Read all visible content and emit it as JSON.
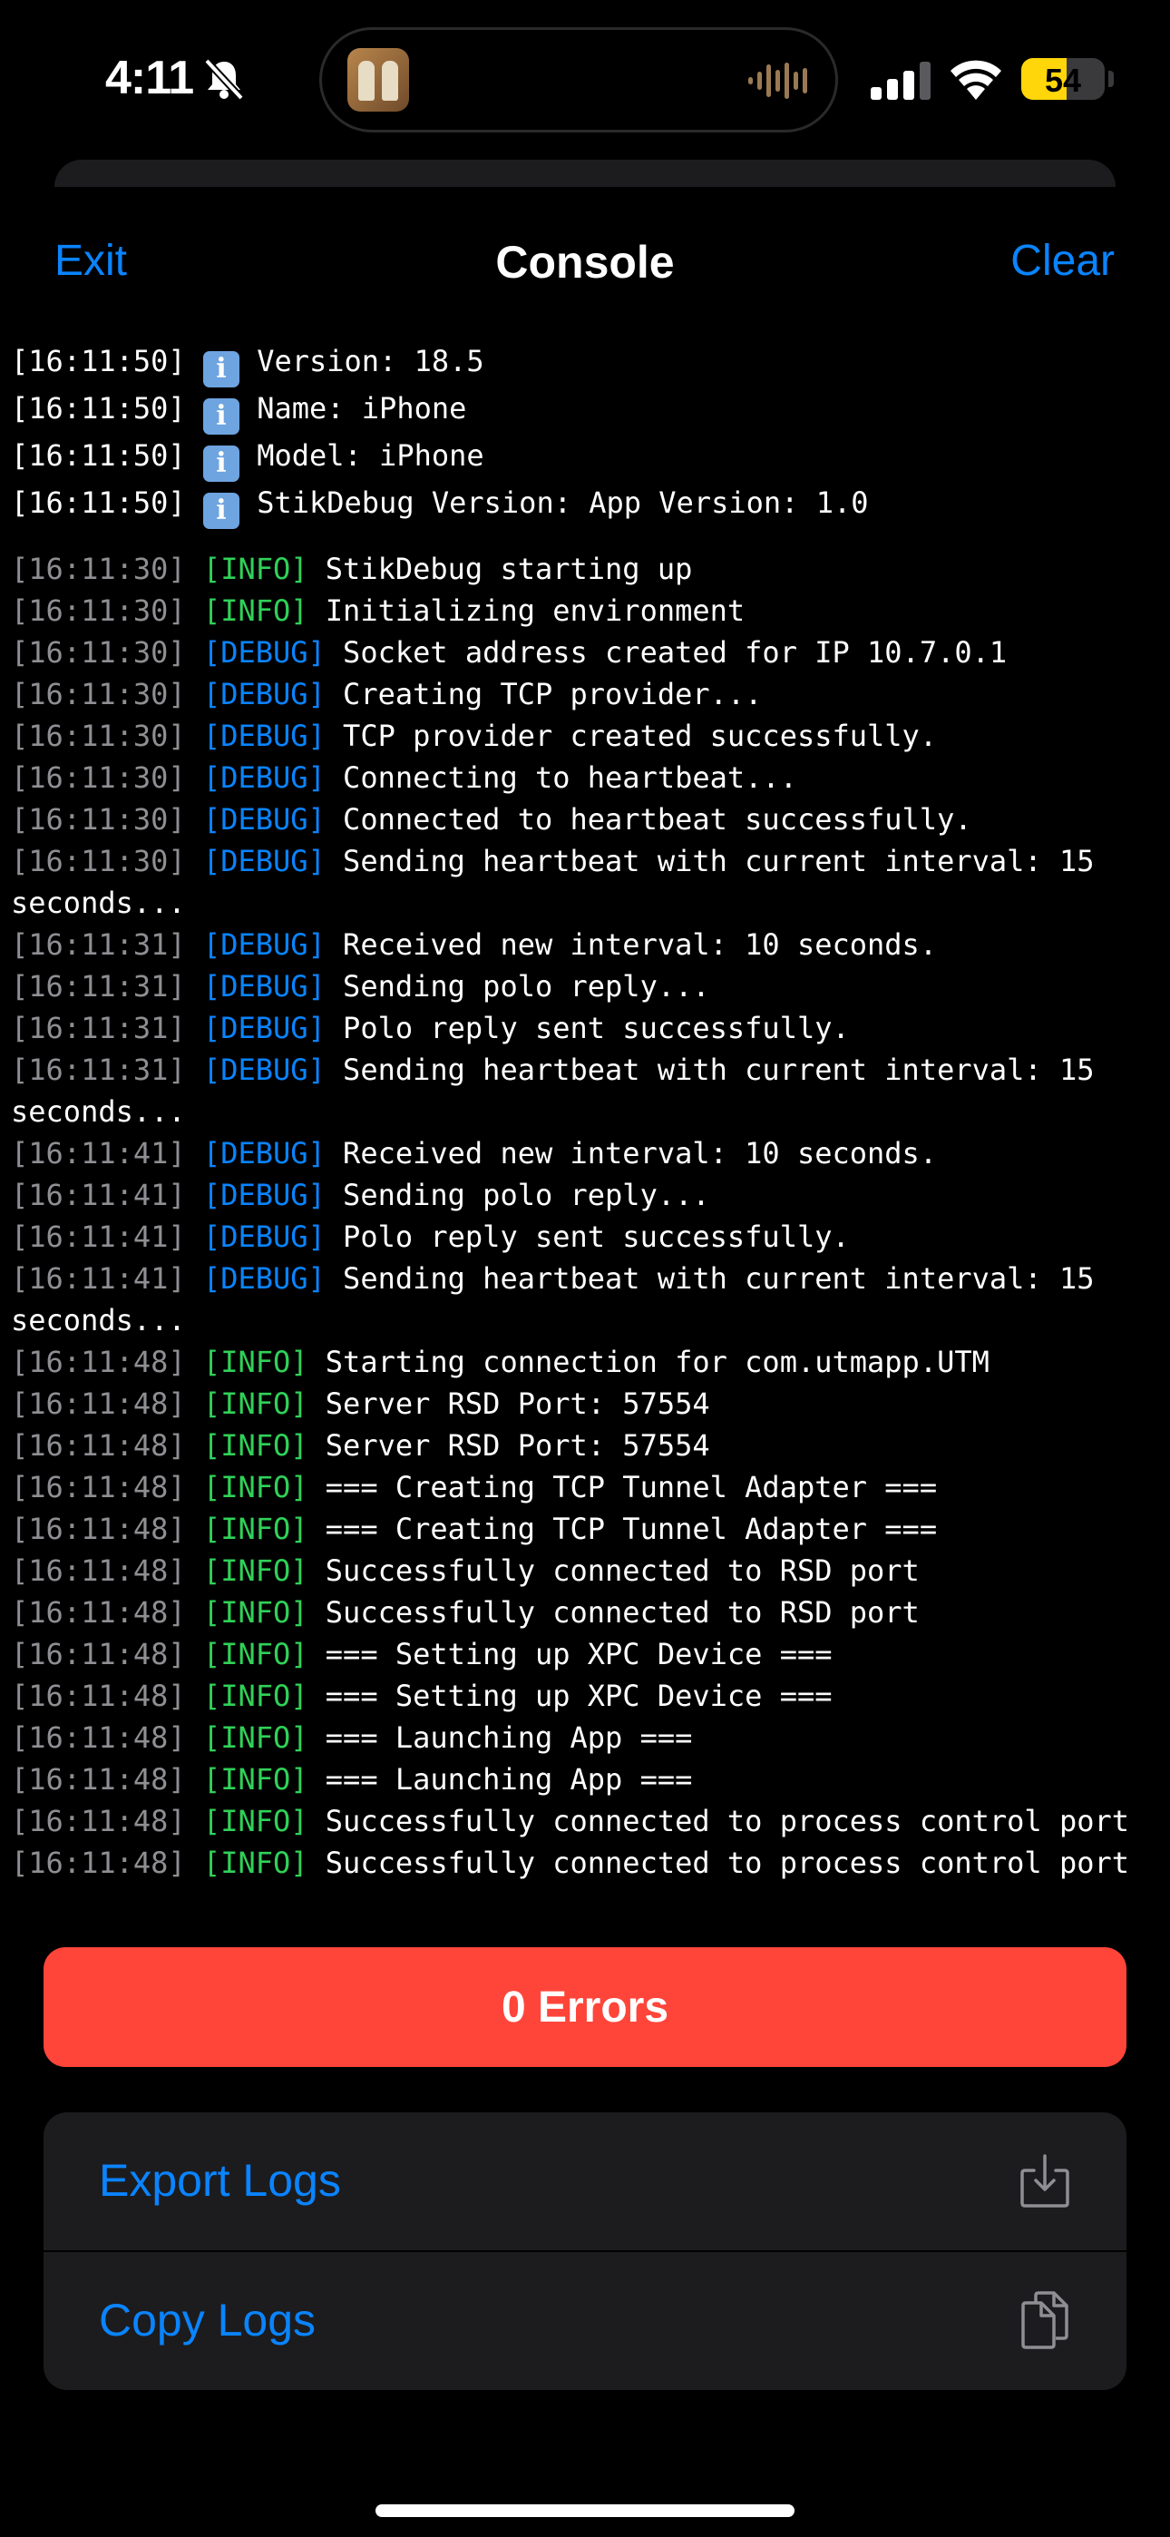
{
  "status_bar": {
    "time": "4:11",
    "battery": "54",
    "battery_level": 0.54,
    "battery_color": "#ffd60a"
  },
  "nav": {
    "exit_label": "Exit",
    "title": "Console",
    "clear_label": "Clear"
  },
  "device_info": [
    {
      "time": "[16:11:50]",
      "text": "Version: 18.5"
    },
    {
      "time": "[16:11:50]",
      "text": "Name: iPhone"
    },
    {
      "time": "[16:11:50]",
      "text": "Model: iPhone"
    },
    {
      "time": "[16:11:50]",
      "text": "StikDebug Version: App Version: 1.0"
    }
  ],
  "logs": [
    {
      "time": "[16:11:30]",
      "level": "[INFO]",
      "message": "StikDebug starting up"
    },
    {
      "time": "[16:11:30]",
      "level": "[INFO]",
      "message": "Initializing environment"
    },
    {
      "time": "[16:11:30]",
      "level": "[DEBUG]",
      "message": "Socket address created for IP 10.7.0.1"
    },
    {
      "time": "[16:11:30]",
      "level": "[DEBUG]",
      "message": "Creating TCP provider..."
    },
    {
      "time": "[16:11:30]",
      "level": "[DEBUG]",
      "message": "TCP provider created successfully."
    },
    {
      "time": "[16:11:30]",
      "level": "[DEBUG]",
      "message": "Connecting to heartbeat..."
    },
    {
      "time": "[16:11:30]",
      "level": "[DEBUG]",
      "message": "Connected to heartbeat successfully."
    },
    {
      "time": "[16:11:30]",
      "level": "[DEBUG]",
      "message": "Sending heartbeat with current interval: 15 seconds..."
    },
    {
      "time": "[16:11:31]",
      "level": "[DEBUG]",
      "message": "Received new interval: 10 seconds."
    },
    {
      "time": "[16:11:31]",
      "level": "[DEBUG]",
      "message": "Sending polo reply..."
    },
    {
      "time": "[16:11:31]",
      "level": "[DEBUG]",
      "message": "Polo reply sent successfully."
    },
    {
      "time": "[16:11:31]",
      "level": "[DEBUG]",
      "message": "Sending heartbeat with current interval: 15 seconds..."
    },
    {
      "time": "[16:11:41]",
      "level": "[DEBUG]",
      "message": "Received new interval: 10 seconds."
    },
    {
      "time": "[16:11:41]",
      "level": "[DEBUG]",
      "message": "Sending polo reply..."
    },
    {
      "time": "[16:11:41]",
      "level": "[DEBUG]",
      "message": "Polo reply sent successfully."
    },
    {
      "time": "[16:11:41]",
      "level": "[DEBUG]",
      "message": "Sending heartbeat with current interval: 15 seconds..."
    },
    {
      "time": "[16:11:48]",
      "level": "[INFO]",
      "message": "Starting connection for com.utmapp.UTM"
    },
    {
      "time": "[16:11:48]",
      "level": "[INFO]",
      "message": "Server RSD Port: 57554"
    },
    {
      "time": "[16:11:48]",
      "level": "[INFO]",
      "message": "Server RSD Port: 57554"
    },
    {
      "time": "[16:11:48]",
      "level": "[INFO]",
      "message": "=== Creating TCP Tunnel Adapter ==="
    },
    {
      "time": "[16:11:48]",
      "level": "[INFO]",
      "message": "=== Creating TCP Tunnel Adapter ==="
    },
    {
      "time": "[16:11:48]",
      "level": "[INFO]",
      "message": "Successfully connected to RSD port"
    },
    {
      "time": "[16:11:48]",
      "level": "[INFO]",
      "message": "Successfully connected to RSD port"
    },
    {
      "time": "[16:11:48]",
      "level": "[INFO]",
      "message": "=== Setting up XPC Device ==="
    },
    {
      "time": "[16:11:48]",
      "level": "[INFO]",
      "message": "=== Setting up XPC Device ==="
    },
    {
      "time": "[16:11:48]",
      "level": "[INFO]",
      "message": "=== Launching App ==="
    },
    {
      "time": "[16:11:48]",
      "level": "[INFO]",
      "message": "=== Launching App ==="
    },
    {
      "time": "[16:11:48]",
      "level": "[INFO]",
      "message": "Successfully connected to process control port"
    },
    {
      "time": "[16:11:48]",
      "level": "[INFO]",
      "message": "Successfully connected to process control port"
    }
  ],
  "errors_button": {
    "label": "0 Errors"
  },
  "actions": {
    "export_label": "Export Logs",
    "copy_label": "Copy Logs"
  },
  "colors": {
    "accent": "#0a84ff",
    "info": "#30d158",
    "debug": "#0a84ff",
    "error_button": "#ff453a",
    "timestamp": "#8e8e93"
  }
}
